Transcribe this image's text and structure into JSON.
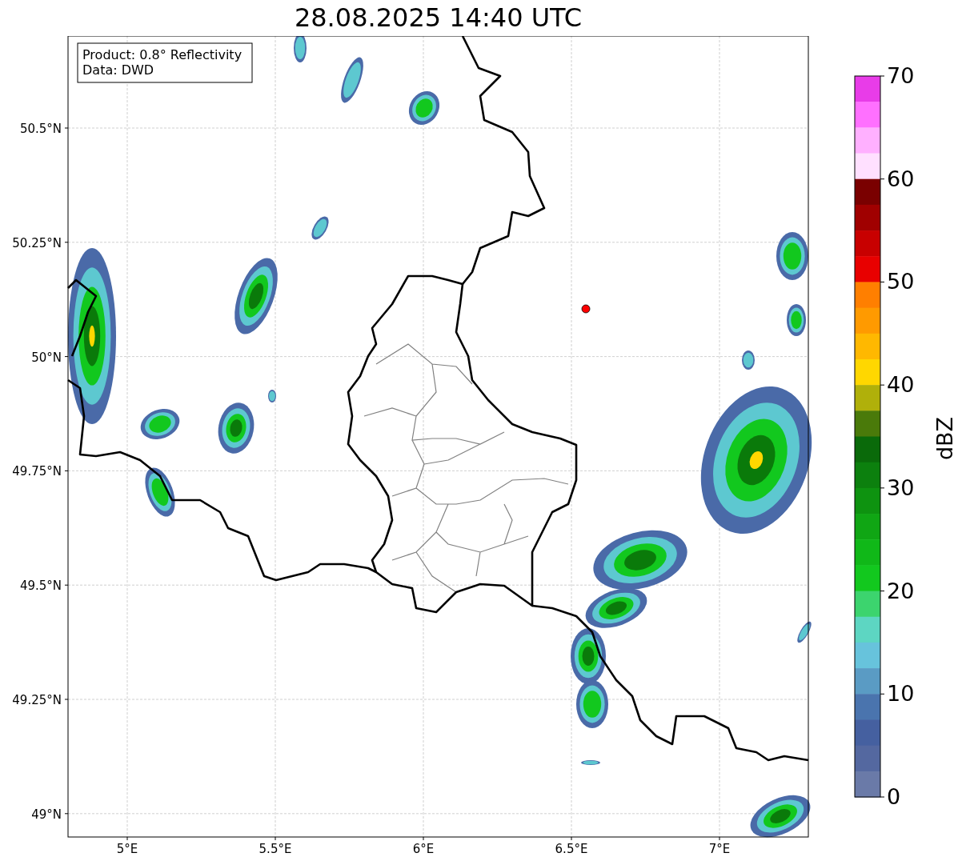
{
  "title": "28.08.2025 14:40 UTC",
  "annotation": [
    "Product: 0.8° Reflectivity",
    "Data: DWD"
  ],
  "x_ticks": [
    "5°E",
    "5.5°E",
    "6°E",
    "6.5°E",
    "7°E"
  ],
  "y_ticks": [
    "50.5°N",
    "50.25°N",
    "50°N",
    "49.75°N",
    "49.5°N",
    "49.25°N",
    "49°N"
  ],
  "colorbar": {
    "label": "dBZ",
    "ticks": [
      "70",
      "60",
      "50",
      "40",
      "30",
      "20",
      "10",
      "0"
    ],
    "segments": [
      {
        "color": "#e83ce8"
      },
      {
        "color": "#ff70ff"
      },
      {
        "color": "#ffb0ff"
      },
      {
        "color": "#ffe0ff"
      },
      {
        "color": "#7a0000"
      },
      {
        "color": "#a00000"
      },
      {
        "color": "#c80000"
      },
      {
        "color": "#e80000"
      },
      {
        "color": "#ff7f00"
      },
      {
        "color": "#ff9a00"
      },
      {
        "color": "#ffb800"
      },
      {
        "color": "#ffd700"
      },
      {
        "color": "#b0b00a"
      },
      {
        "color": "#4a7a0a"
      },
      {
        "color": "#0a6a0a"
      },
      {
        "color": "#0c800e"
      },
      {
        "color": "#0e9310"
      },
      {
        "color": "#10a614"
      },
      {
        "color": "#10b818"
      },
      {
        "color": "#12c81e"
      },
      {
        "color": "#3cd46e"
      },
      {
        "color": "#5dd6c2"
      },
      {
        "color": "#67c3dc"
      },
      {
        "color": "#5a9bc4"
      },
      {
        "color": "#4a74ae"
      },
      {
        "color": "#4560a0"
      },
      {
        "color": "#5468a0"
      },
      {
        "color": "#6a7aa8"
      }
    ]
  }
}
